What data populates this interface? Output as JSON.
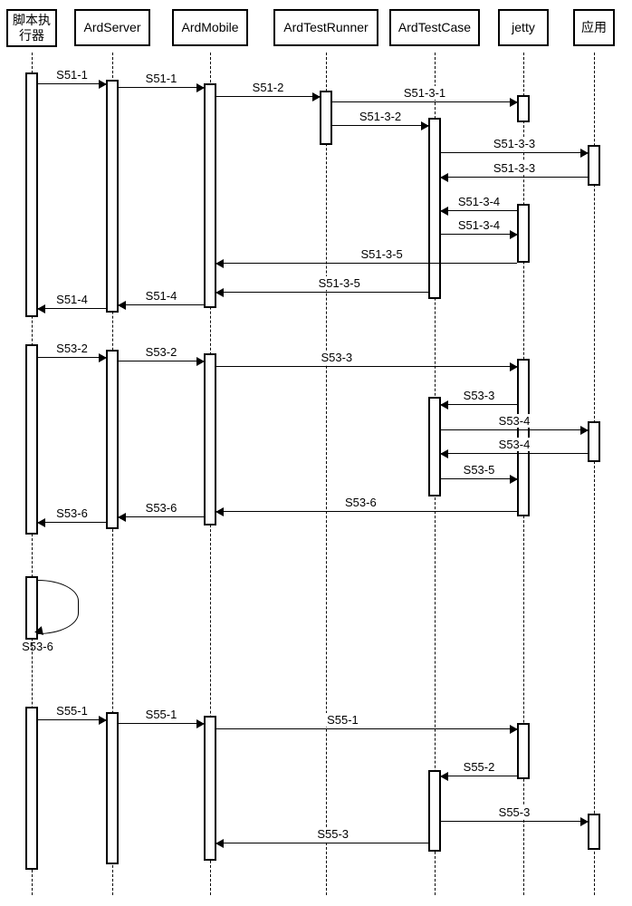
{
  "participants": {
    "p0_name_l1": "脚本执",
    "p0_name_l2": "行器",
    "p1_name": "ArdServer",
    "p2_name": "ArdMobile",
    "p3_name": "ArdTestRunner",
    "p4_name": "ArdTestCase",
    "p5_name": "jetty",
    "p6_name": "应用"
  },
  "chart_data": {
    "type": "sequence-diagram",
    "participants": [
      "脚本执行器",
      "ArdServer",
      "ArdMobile",
      "ArdTestRunner",
      "ArdTestCase",
      "jetty",
      "应用"
    ],
    "sections": [
      {
        "messages": [
          {
            "label": "S51-1",
            "from": "脚本执行器",
            "to": "ArdServer",
            "dir": "right"
          },
          {
            "label": "S51-1",
            "from": "ArdServer",
            "to": "ArdMobile",
            "dir": "right"
          },
          {
            "label": "S51-2",
            "from": "ArdMobile",
            "to": "ArdTestRunner",
            "dir": "right"
          },
          {
            "label": "S51-3-1",
            "from": "ArdTestRunner",
            "to": "jetty",
            "dir": "right"
          },
          {
            "label": "S51-3-2",
            "from": "ArdTestRunner",
            "to": "ArdTestCase",
            "dir": "right"
          },
          {
            "label": "S51-3-3",
            "from": "ArdTestCase",
            "to": "应用",
            "dir": "right"
          },
          {
            "label": "S51-3-3",
            "from": "应用",
            "to": "ArdTestCase",
            "dir": "left"
          },
          {
            "label": "S51-3-4",
            "from": "jetty",
            "to": "ArdTestCase",
            "dir": "left"
          },
          {
            "label": "S51-3-4",
            "from": "ArdTestCase",
            "to": "jetty",
            "dir": "right"
          },
          {
            "label": "S51-3-5",
            "from": "jetty",
            "to": "ArdMobile",
            "dir": "left"
          },
          {
            "label": "S51-3-5",
            "from": "ArdTestCase",
            "to": "ArdMobile",
            "dir": "left"
          },
          {
            "label": "S51-4",
            "from": "ArdMobile",
            "to": "ArdServer",
            "dir": "left"
          },
          {
            "label": "S51-4",
            "from": "ArdServer",
            "to": "脚本执行器",
            "dir": "left"
          }
        ]
      },
      {
        "messages": [
          {
            "label": "S53-2",
            "from": "脚本执行器",
            "to": "ArdServer",
            "dir": "right"
          },
          {
            "label": "S53-2",
            "from": "ArdServer",
            "to": "ArdMobile",
            "dir": "right"
          },
          {
            "label": "S53-3",
            "from": "ArdMobile",
            "to": "jetty",
            "dir": "right"
          },
          {
            "label": "S53-3",
            "from": "jetty",
            "to": "ArdTestCase",
            "dir": "left"
          },
          {
            "label": "S53-4",
            "from": "ArdTestCase",
            "to": "应用",
            "dir": "right"
          },
          {
            "label": "S53-4",
            "from": "应用",
            "to": "ArdTestCase",
            "dir": "left"
          },
          {
            "label": "S53-5",
            "from": "ArdTestCase",
            "to": "jetty",
            "dir": "right"
          },
          {
            "label": "S53-6",
            "from": "jetty",
            "to": "ArdMobile",
            "dir": "left"
          },
          {
            "label": "S53-6",
            "from": "ArdMobile",
            "to": "ArdServer",
            "dir": "left"
          },
          {
            "label": "S53-6",
            "from": "ArdServer",
            "to": "脚本执行器",
            "dir": "left"
          },
          {
            "label": "S53-6",
            "from": "脚本执行器",
            "to": "脚本执行器",
            "dir": "self"
          }
        ]
      },
      {
        "messages": [
          {
            "label": "S55-1",
            "from": "脚本执行器",
            "to": "ArdServer",
            "dir": "right"
          },
          {
            "label": "S55-1",
            "from": "ArdServer",
            "to": "ArdMobile",
            "dir": "right"
          },
          {
            "label": "S55-1",
            "from": "ArdMobile",
            "to": "jetty",
            "dir": "right"
          },
          {
            "label": "S55-2",
            "from": "jetty",
            "to": "ArdTestCase",
            "dir": "left"
          },
          {
            "label": "S55-3",
            "from": "ArdTestCase",
            "to": "应用",
            "dir": "right"
          },
          {
            "label": "S55-3",
            "from": "ArdTestCase",
            "to": "ArdMobile",
            "dir": "left"
          }
        ]
      }
    ]
  },
  "labels": {
    "m1": "S51-1",
    "m2": "S51-1",
    "m3": "S51-2",
    "m4": "S51-3-1",
    "m5": "S51-3-2",
    "m6": "S51-3-3",
    "m7": "S51-3-3",
    "m8": "S51-3-4",
    "m9": "S51-3-4",
    "m10": "S51-3-5",
    "m11": "S51-3-5",
    "m12": "S51-4",
    "m13": "S51-4",
    "m14": "S53-2",
    "m15": "S53-2",
    "m16": "S53-3",
    "m17": "S53-3",
    "m18": "S53-4",
    "m19": "S53-4",
    "m20": "S53-5",
    "m21": "S53-6",
    "m22": "S53-6",
    "m23": "S53-6",
    "m24": "S53-6",
    "m25": "S55-1",
    "m26": "S55-1",
    "m27": "S55-1",
    "m28": "S55-2",
    "m29": "S55-3",
    "m30": "S55-3"
  }
}
